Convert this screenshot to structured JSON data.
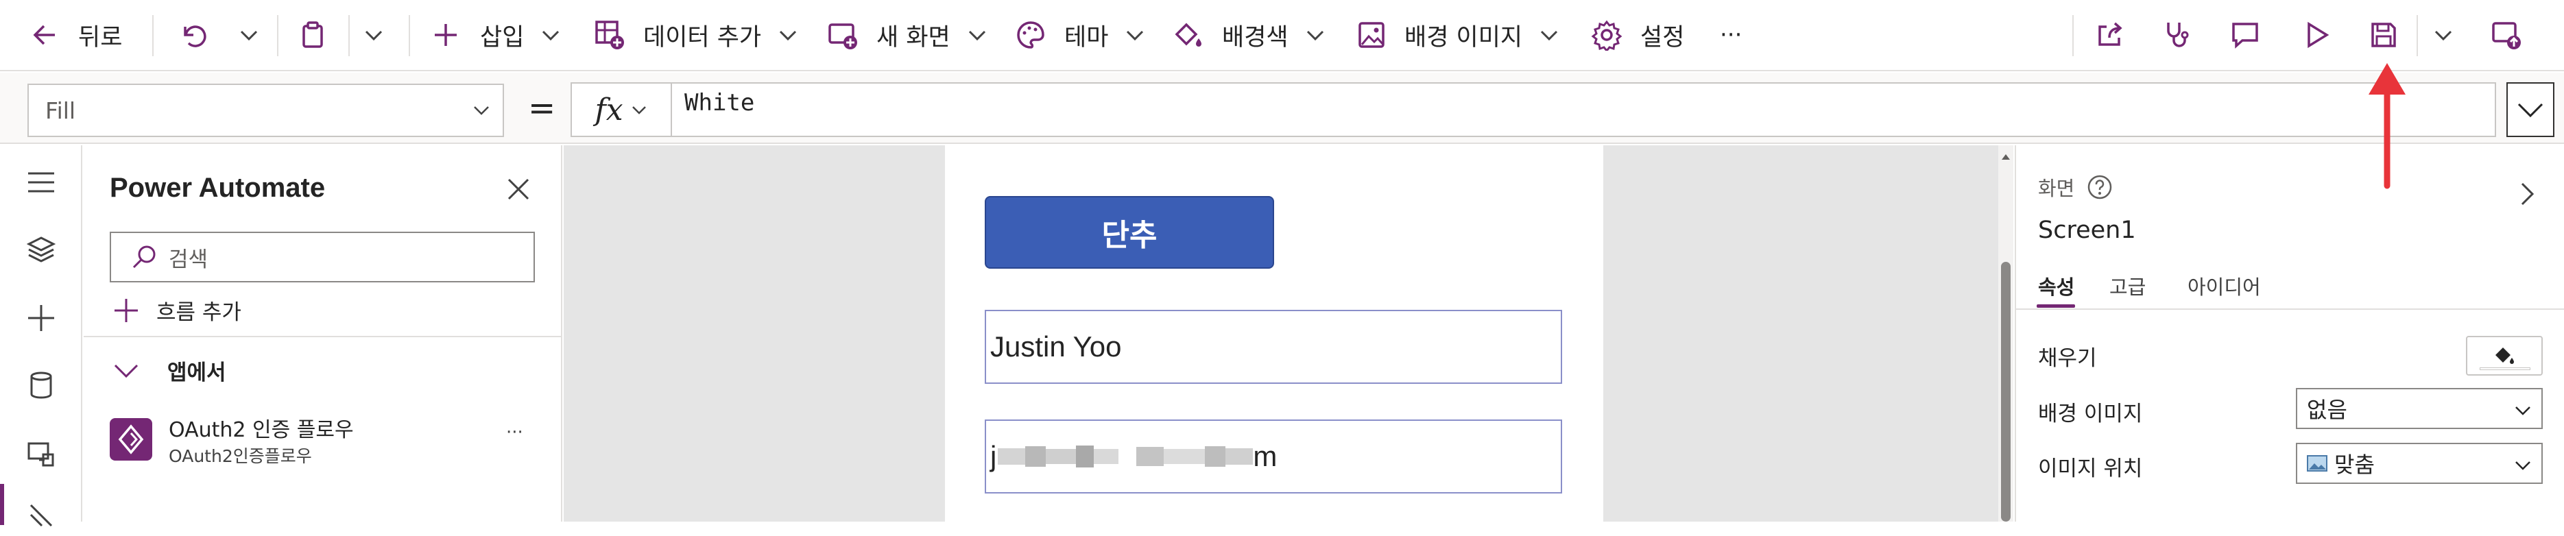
{
  "toolbar": {
    "back": "뒤로",
    "insert": "삽입",
    "add_data": "데이터 추가",
    "new_screen": "새 화면",
    "theme": "테마",
    "background_color": "배경색",
    "background_image": "배경 이미지",
    "settings": "설정",
    "more": "···"
  },
  "formula_bar": {
    "property": "Fill",
    "equals": "=",
    "fx": "fx",
    "formula": "White"
  },
  "flow_panel": {
    "title": "Power Automate",
    "search_placeholder": "검색",
    "add_flow": "흐름 추가",
    "section": "앱에서",
    "flow_name": "OAuth2 인증 플로우",
    "flow_subtitle": "OAuth2인증플로우",
    "flow_more": "···"
  },
  "canvas": {
    "button_label": "단추",
    "input1_value": "Justin Yoo",
    "input2_prefix": "j",
    "input2_suffix": "m"
  },
  "properties": {
    "section_label": "화면",
    "screen_name": "Screen1",
    "tabs": [
      "속성",
      "고급",
      "아이디어"
    ],
    "fill_label": "채우기",
    "bg_image_label": "배경 이미지",
    "bg_image_value": "없음",
    "image_position_label": "이미지 위치",
    "image_position_value": "맞춤"
  },
  "colors": {
    "accent": "#742774",
    "button": "#3b5eb5",
    "arrow": "#e8343a"
  }
}
